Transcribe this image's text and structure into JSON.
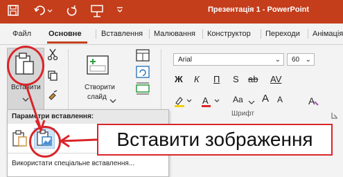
{
  "titlebar": {
    "title": "Презентація 1  -  PowerPoint",
    "icons": [
      "save-icon",
      "undo-icon",
      "redo-icon",
      "present-icon",
      "customize-icon"
    ],
    "color": "#c43e1c"
  },
  "tabs": [
    {
      "label": "Файл",
      "active": false
    },
    {
      "label": "Основне",
      "active": true
    },
    {
      "label": "Вставлення",
      "active": false
    },
    {
      "label": "Малювання",
      "active": false
    },
    {
      "label": "Конструктор",
      "active": false
    },
    {
      "label": "Переходи",
      "active": false
    },
    {
      "label": "Анімація",
      "active": false
    }
  ],
  "clipboard": {
    "paste_label": "Вставити",
    "icons": [
      "paste-icon",
      "cut-icon",
      "copy-icon",
      "format-painter-icon"
    ]
  },
  "slides": {
    "new_slide_label_line1": "Створити",
    "new_slide_label_line2": "слайд"
  },
  "font": {
    "font_name": "Arial",
    "font_size": "60",
    "group_label": "Шрифт",
    "bold": "Ж",
    "italic": "К",
    "underline": "П",
    "strike": "S",
    "strikethrough_label": "ab",
    "spacing": "AV",
    "case": "Aa",
    "grow": "A",
    "shrink": "A"
  },
  "paste_menu": {
    "header": "Параметри вставлення:",
    "special": "Використати спеціальне вставлення..."
  },
  "callout": {
    "text": "Вставити зображення",
    "color": "#d9252a"
  }
}
